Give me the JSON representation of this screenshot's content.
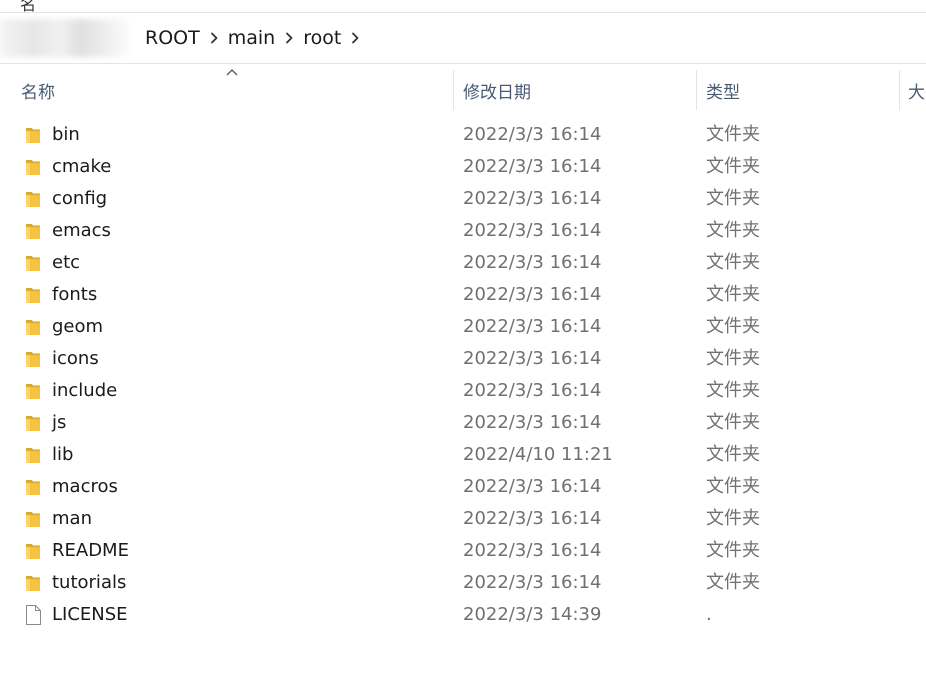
{
  "top_strip": {
    "cut_text": "名"
  },
  "breadcrumb": {
    "items": [
      "ROOT",
      "main",
      "root"
    ]
  },
  "columns": {
    "name": "名称",
    "modified": "修改日期",
    "type": "类型",
    "size": "大"
  },
  "sort": {
    "column": "name",
    "direction": "ascending"
  },
  "files": [
    {
      "name": "bin",
      "modified": "2022/3/3 16:14",
      "type": "文件夹",
      "icon": "folder-icon"
    },
    {
      "name": "cmake",
      "modified": "2022/3/3 16:14",
      "type": "文件夹",
      "icon": "folder-icon"
    },
    {
      "name": "config",
      "modified": "2022/3/3 16:14",
      "type": "文件夹",
      "icon": "folder-icon"
    },
    {
      "name": "emacs",
      "modified": "2022/3/3 16:14",
      "type": "文件夹",
      "icon": "folder-icon"
    },
    {
      "name": "etc",
      "modified": "2022/3/3 16:14",
      "type": "文件夹",
      "icon": "folder-icon"
    },
    {
      "name": "fonts",
      "modified": "2022/3/3 16:14",
      "type": "文件夹",
      "icon": "folder-icon"
    },
    {
      "name": "geom",
      "modified": "2022/3/3 16:14",
      "type": "文件夹",
      "icon": "folder-icon"
    },
    {
      "name": "icons",
      "modified": "2022/3/3 16:14",
      "type": "文件夹",
      "icon": "folder-icon"
    },
    {
      "name": "include",
      "modified": "2022/3/3 16:14",
      "type": "文件夹",
      "icon": "folder-icon"
    },
    {
      "name": "js",
      "modified": "2022/3/3 16:14",
      "type": "文件夹",
      "icon": "folder-icon"
    },
    {
      "name": "lib",
      "modified": "2022/4/10 11:21",
      "type": "文件夹",
      "icon": "folder-icon"
    },
    {
      "name": "macros",
      "modified": "2022/3/3 16:14",
      "type": "文件夹",
      "icon": "folder-icon"
    },
    {
      "name": "man",
      "modified": "2022/3/3 16:14",
      "type": "文件夹",
      "icon": "folder-icon"
    },
    {
      "name": "README",
      "modified": "2022/3/3 16:14",
      "type": "文件夹",
      "icon": "folder-icon"
    },
    {
      "name": "tutorials",
      "modified": "2022/3/3 16:14",
      "type": "文件夹",
      "icon": "folder-icon"
    },
    {
      "name": "LICENSE",
      "modified": "2022/3/3 14:39",
      "type": ".",
      "icon": "file-icon"
    }
  ],
  "colors": {
    "folder": "#f5c242",
    "folder_dark": "#dca92a",
    "header_text": "#4a5a75",
    "secondary_text": "#707070",
    "divider": "#e5e5e5"
  }
}
